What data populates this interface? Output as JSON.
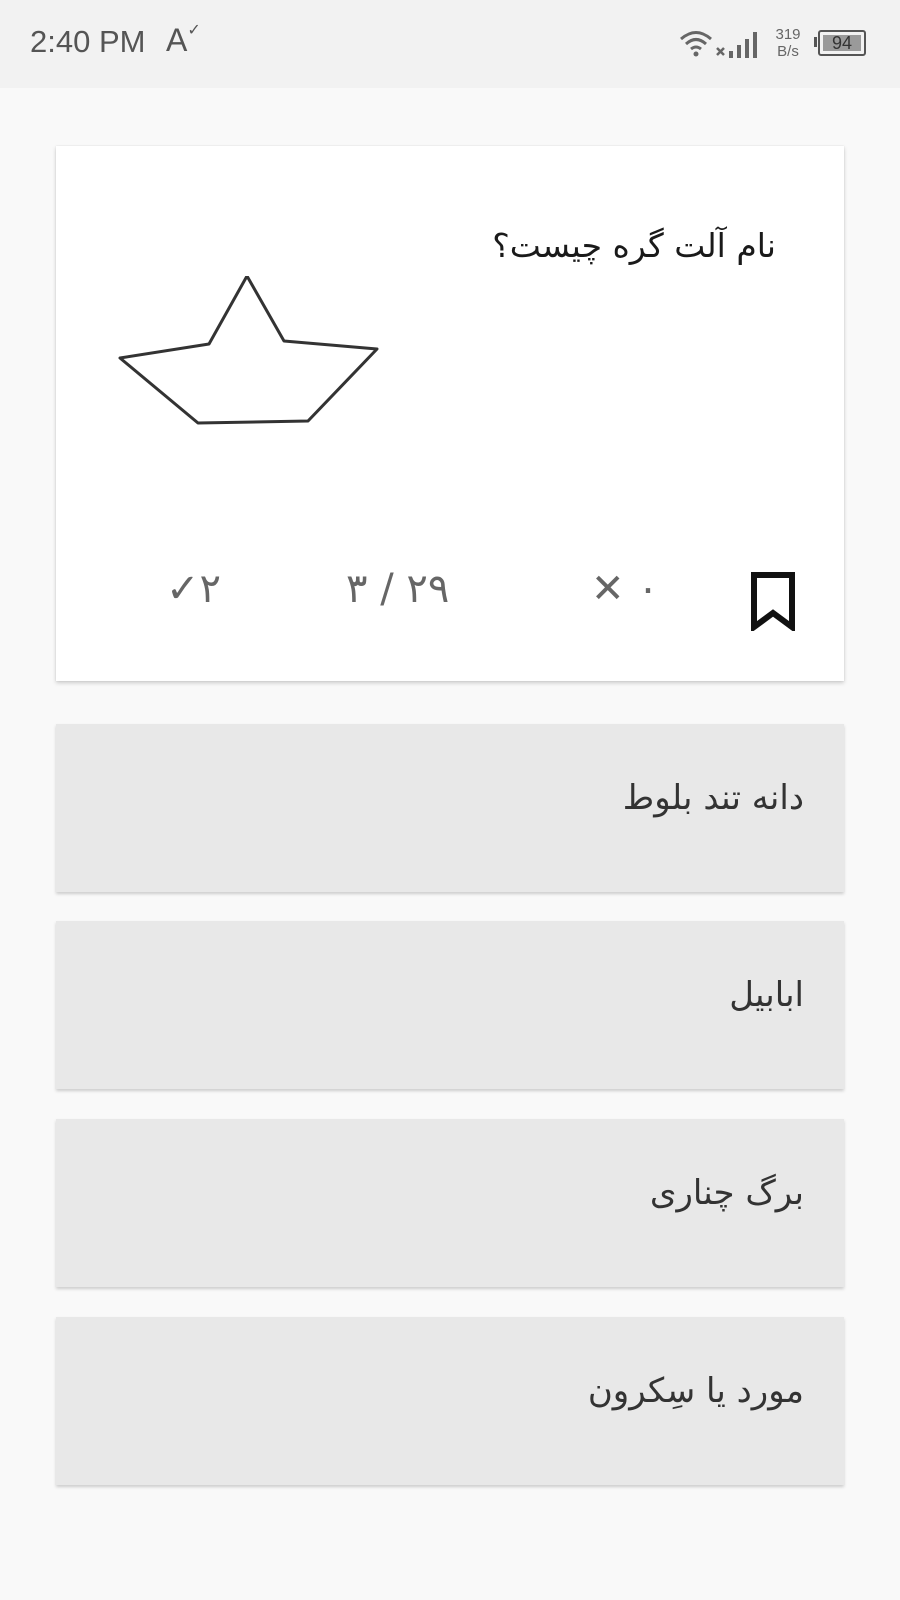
{
  "status_bar": {
    "time": "2:40 PM",
    "accessibility_glyph": "A",
    "accessibility_check": "✓",
    "net_speed_value": "319",
    "net_speed_unit": "B/s",
    "battery_level": "94",
    "icons": [
      "wifi-icon",
      "cellular-signal-icon",
      "battery-icon"
    ]
  },
  "question": {
    "text": "نام آلت گره چیست؟",
    "illustration": "knot-outline-image"
  },
  "stats": {
    "correct": "✓۲",
    "progress": "۳ / ۲۹",
    "wrong": "✕ ۰",
    "bookmark_icon": "bookmark-icon"
  },
  "answers": [
    {
      "label": "دانه تند بلوط"
    },
    {
      "label": "ابابیل"
    },
    {
      "label": "برگ چناری"
    },
    {
      "label": "مورد یا سِکرون"
    }
  ],
  "colors": {
    "page_background": "#f9f9f9",
    "card_background": "#ffffff",
    "answer_background": "#e8e8e8",
    "status_bar_background": "#f2f2f2"
  }
}
